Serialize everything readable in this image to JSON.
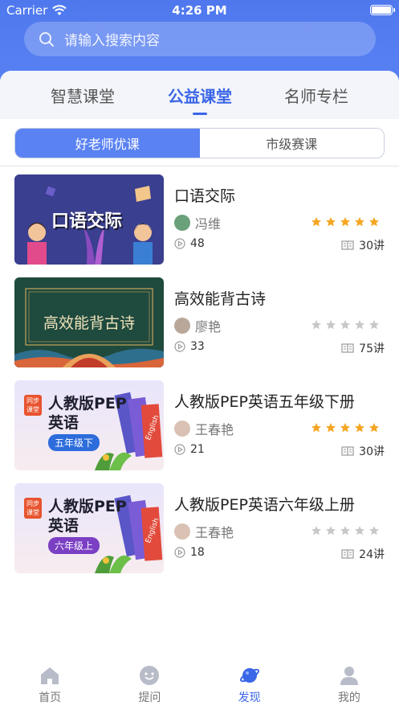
{
  "status_bar": {
    "carrier": "Carrier",
    "time": "4:26 PM"
  },
  "search": {
    "placeholder": "请输入搜索内容"
  },
  "tabs": [
    {
      "label": "智慧课堂",
      "active": false
    },
    {
      "label": "公益课堂",
      "active": true
    },
    {
      "label": "名师专栏",
      "active": false
    }
  ],
  "segments": [
    {
      "label": "好老师优课",
      "active": true
    },
    {
      "label": "市级赛课",
      "active": false
    }
  ],
  "courses": [
    {
      "title": "口语交际",
      "teacher": "冯维",
      "rating": 5,
      "plays": "48",
      "lessons": "30讲",
      "thumb_text": "口语交际"
    },
    {
      "title": "高效能背古诗",
      "teacher": "廖艳",
      "rating": 0,
      "plays": "33",
      "lessons": "75讲",
      "thumb_text": "高效能背古诗"
    },
    {
      "title": "人教版PEP英语五年级下册",
      "teacher": "王春艳",
      "rating": 5,
      "plays": "21",
      "lessons": "30讲",
      "thumb_tag": "同步课堂",
      "thumb_title": "人教版PEP",
      "thumb_sub": "英语",
      "thumb_grade": "五年级下",
      "thumb_book": "English"
    },
    {
      "title": "人教版PEP英语六年级上册",
      "teacher": "王春艳",
      "rating": 0,
      "plays": "18",
      "lessons": "24讲",
      "thumb_tag": "同步课堂",
      "thumb_title": "人教版PEP",
      "thumb_sub": "英语",
      "thumb_grade": "六年级上",
      "thumb_book": "English"
    }
  ],
  "tabbar": [
    {
      "label": "首页",
      "icon": "home-icon",
      "active": false
    },
    {
      "label": "提问",
      "icon": "question-icon",
      "active": false
    },
    {
      "label": "发现",
      "icon": "discover-planet-icon",
      "active": true
    },
    {
      "label": "我的",
      "icon": "profile-icon",
      "active": false
    }
  ],
  "colors": {
    "accent": "#3a66e8",
    "header": "#5a82f3",
    "star_on": "#f5a623",
    "star_off": "#c8c8c8"
  }
}
